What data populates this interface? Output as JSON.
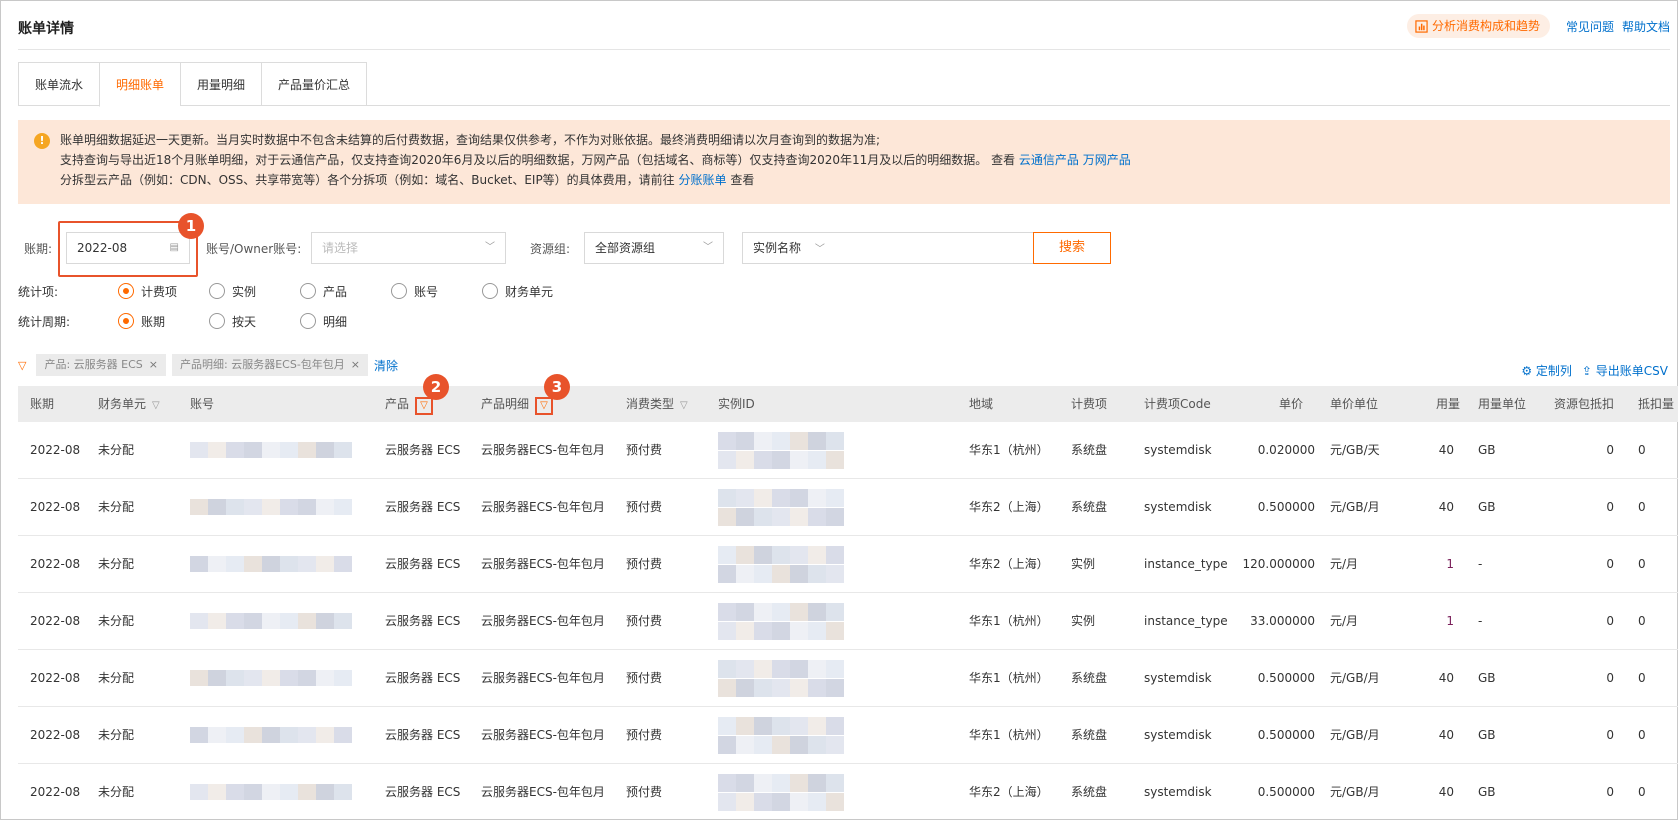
{
  "header": {
    "title": "账单详情",
    "analyze_label": "分析消费构成和趋势",
    "faq": "常见问题",
    "help": "帮助文档"
  },
  "tabs": [
    "账单流水",
    "明细账单",
    "用量明细",
    "产品量价汇总"
  ],
  "active_tab": 1,
  "notice": {
    "line1": "账单明细数据延迟一天更新。当月实时数据中不包含未结算的后付费数据，查询结果仅供参考，不作为对账依据。最终消费明细请以次月查询到的数据为准;",
    "line2": "支持查询与导出近18个月账单明细，对于云通信产品，仅支持查询2020年6月及以后的明细数据，万网产品（包括域名、商标等）仅支持查询2020年11月及以后的明细数据。 查看",
    "link_cloudcomm": "云通信产品",
    "link_wanwang": "万网产品",
    "line3": "分拆型云产品（例如：CDN、OSS、共享带宽等）各个分拆项（例如：域名、Bucket、EIP等）的具体费用，请前往",
    "link_split": "分账账单",
    "line3_end": "查看"
  },
  "filters": {
    "period_label": "账期:",
    "period_value": "2022-08",
    "account_label": "账号/Owner账号:",
    "account_placeholder": "请选择",
    "resgroup_label": "资源组:",
    "resgroup_value": "全部资源组",
    "instance_select": "实例名称",
    "search_label": "搜索"
  },
  "stat_item": {
    "label": "统计项:",
    "options": [
      "计费项",
      "实例",
      "产品",
      "账号",
      "财务单元"
    ],
    "selected": 0
  },
  "stat_period": {
    "label": "统计周期:",
    "options": [
      "账期",
      "按天",
      "明细"
    ],
    "selected": 0
  },
  "chips": [
    "产品: 云服务器 ECS",
    "产品明细: 云服务器ECS-包年包月"
  ],
  "clear_label": "清除",
  "tools": {
    "customize": "定制列",
    "export": "导出账单CSV"
  },
  "markers": [
    "1",
    "2",
    "3"
  ],
  "columns": [
    "账期",
    "财务单元",
    "账号",
    "产品",
    "产品明细",
    "消费类型",
    "实例ID",
    "地域",
    "计费项",
    "计费项Code",
    "单价",
    "单价单位",
    "用量",
    "用量单位",
    "资源包抵扣",
    "抵扣量"
  ],
  "rows": [
    {
      "period": "2022-08",
      "unit": "未分配",
      "product": "云服务器 ECS",
      "detail": "云服务器ECS-包年包月",
      "type": "预付费",
      "region": "华东1（杭州）",
      "item": "系统盘",
      "code": "systemdisk",
      "price": "0.020000",
      "price_unit": "元/GB/天",
      "usage": "40",
      "usage_unit": "GB",
      "res_pkg": "0",
      "deduct": "0"
    },
    {
      "period": "2022-08",
      "unit": "未分配",
      "product": "云服务器 ECS",
      "detail": "云服务器ECS-包年包月",
      "type": "预付费",
      "region": "华东2（上海）",
      "item": "系统盘",
      "code": "systemdisk",
      "price": "0.500000",
      "price_unit": "元/GB/月",
      "usage": "40",
      "usage_unit": "GB",
      "res_pkg": "0",
      "deduct": "0"
    },
    {
      "period": "2022-08",
      "unit": "未分配",
      "product": "云服务器 ECS",
      "detail": "云服务器ECS-包年包月",
      "type": "预付费",
      "region": "华东2（上海）",
      "item": "实例",
      "code": "instance_type",
      "price": "120.000000",
      "price_unit": "元/月",
      "usage": "1",
      "usage_unit": "-",
      "res_pkg": "0",
      "deduct": "0"
    },
    {
      "period": "2022-08",
      "unit": "未分配",
      "product": "云服务器 ECS",
      "detail": "云服务器ECS-包年包月",
      "type": "预付费",
      "region": "华东1（杭州）",
      "item": "实例",
      "code": "instance_type",
      "price": "33.000000",
      "price_unit": "元/月",
      "usage": "1",
      "usage_unit": "-",
      "res_pkg": "0",
      "deduct": "0"
    },
    {
      "period": "2022-08",
      "unit": "未分配",
      "product": "云服务器 ECS",
      "detail": "云服务器ECS-包年包月",
      "type": "预付费",
      "region": "华东1（杭州）",
      "item": "系统盘",
      "code": "systemdisk",
      "price": "0.500000",
      "price_unit": "元/GB/月",
      "usage": "40",
      "usage_unit": "GB",
      "res_pkg": "0",
      "deduct": "0"
    },
    {
      "period": "2022-08",
      "unit": "未分配",
      "product": "云服务器 ECS",
      "detail": "云服务器ECS-包年包月",
      "type": "预付费",
      "region": "华东1（杭州）",
      "item": "系统盘",
      "code": "systemdisk",
      "price": "0.500000",
      "price_unit": "元/GB/月",
      "usage": "40",
      "usage_unit": "GB",
      "res_pkg": "0",
      "deduct": "0"
    },
    {
      "period": "2022-08",
      "unit": "未分配",
      "product": "云服务器 ECS",
      "detail": "云服务器ECS-包年包月",
      "type": "预付费",
      "region": "华东2（上海）",
      "item": "系统盘",
      "code": "systemdisk",
      "price": "0.500000",
      "price_unit": "元/GB/月",
      "usage": "40",
      "usage_unit": "GB",
      "res_pkg": "0",
      "deduct": "0"
    }
  ],
  "colors": {
    "accent": "#ff6a00",
    "link": "#0070cc",
    "notice_bg": "#fde7d8",
    "annotation": "#e8532b"
  }
}
